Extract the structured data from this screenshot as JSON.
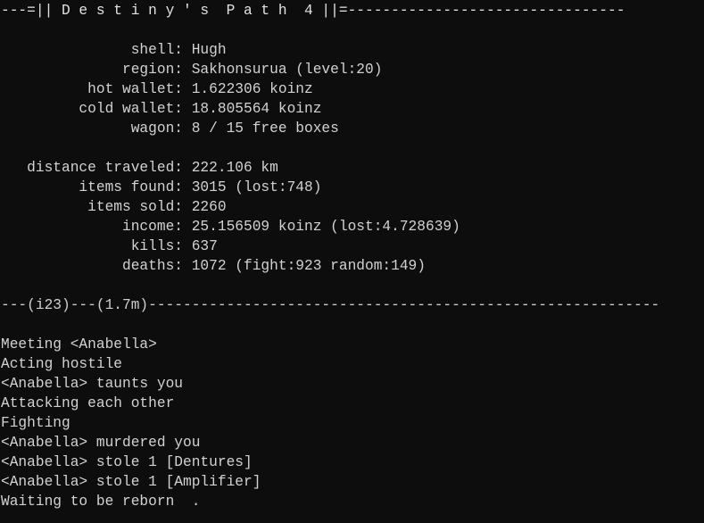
{
  "terminal": {
    "background_color": "#0d0d0d",
    "foreground_color": "#d2d2d2",
    "columns": 80,
    "rows": 26
  },
  "header": {
    "title_line": "---=|| D e s t i n y ' s  P a t h  4 ||=--------------------------------",
    "game_title": "Destiny's Path 4"
  },
  "character": {
    "rows": [
      {
        "label": "shell",
        "value": "Hugh",
        "line": "               shell: Hugh"
      },
      {
        "label": "region",
        "value": "Sakhonsurua (level:20)",
        "line": "              region: Sakhonsurua (level:20)"
      },
      {
        "label": "hot wallet",
        "value": "1.622306 koinz",
        "line": "          hot wallet: 1.622306 koinz"
      },
      {
        "label": "cold wallet",
        "value": "18.805564 koinz",
        "line": "         cold wallet: 18.805564 koinz"
      },
      {
        "label": "wagon",
        "value": "8 / 15 free boxes",
        "line": "               wagon: 8 / 15 free boxes"
      }
    ]
  },
  "stats": {
    "rows": [
      {
        "label": "distance traveled",
        "value": "222.106 km",
        "line": "   distance traveled: 222.106 km"
      },
      {
        "label": "items found",
        "value": "3015 (lost:748)",
        "line": "         items found: 3015 (lost:748)"
      },
      {
        "label": "items sold",
        "value": "2260",
        "line": "          items sold: 2260"
      },
      {
        "label": "income",
        "value": "25.156509 koinz (lost:4.728639)",
        "line": "              income: 25.156509 koinz (lost:4.728639)"
      },
      {
        "label": "kills",
        "value": "637",
        "line": "               kills: 637"
      },
      {
        "label": "deaths",
        "value": "1072 (fight:923 random:149)",
        "line": "              deaths: 1072 (fight:923 random:149)"
      }
    ]
  },
  "separator": {
    "iteration": "i23",
    "elapsed": "1.7m",
    "line": "---(i23)---(1.7m)-----------------------------------------------------------"
  },
  "log": {
    "entries": [
      "Meeting <Anabella>",
      "Acting hostile",
      "<Anabella> taunts you",
      "Attacking each other",
      "Fighting",
      "<Anabella> murdered you",
      "<Anabella> stole 1 [Dentures]",
      "<Anabella> stole 1 [Amplifier]",
      "Waiting to be reborn  ."
    ]
  }
}
